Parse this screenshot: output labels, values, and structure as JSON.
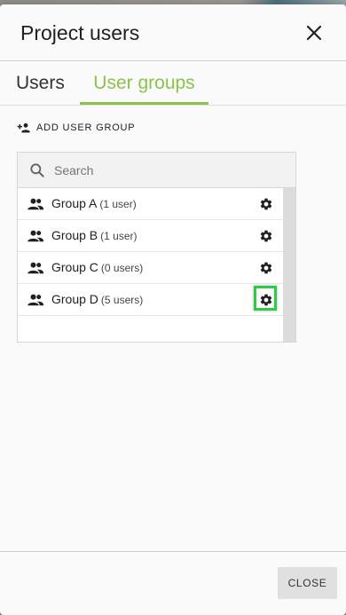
{
  "dialog": {
    "title": "Project users",
    "close_icon": "close-icon"
  },
  "tabs": [
    {
      "label": "Users",
      "active": false
    },
    {
      "label": "User groups",
      "active": true
    }
  ],
  "accent_color": "#8bc34a",
  "add_group": {
    "label": "ADD USER GROUP",
    "icon": "add-group-icon"
  },
  "search": {
    "placeholder": "Search",
    "value": ""
  },
  "groups": [
    {
      "name": "Group A",
      "count": "(1 user)"
    },
    {
      "name": "Group B",
      "count": "(1 user)"
    },
    {
      "name": "Group C",
      "count": "(0 users)"
    },
    {
      "name": "Group D",
      "count": "(5 users)",
      "highlighted": true
    }
  ],
  "highlight_color": "#2ecc40",
  "footer": {
    "close_label": "CLOSE"
  }
}
